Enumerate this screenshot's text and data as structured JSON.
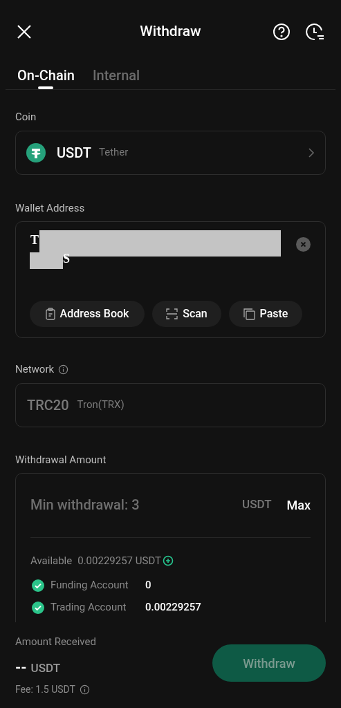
{
  "header": {
    "title": "Withdraw"
  },
  "tabs": [
    {
      "label": "On-Chain",
      "selected": true
    },
    {
      "label": "Internal",
      "selected": false
    }
  ],
  "coin": {
    "label": "Coin",
    "symbol": "USDT",
    "name": "Tether"
  },
  "wallet_address": {
    "label": "Wallet Address",
    "line_1": "T",
    "line_2": "S",
    "buttons": [
      "Address Book",
      "Scan",
      "Paste"
    ]
  },
  "network": {
    "label": "Network",
    "value": "TRC20",
    "name": "Tron(TRX)"
  },
  "withdrawal_amount": {
    "label": "Withdrawal Amount",
    "placeholder": "Min withdrawal: 3",
    "unit": "USDT",
    "max": "Max",
    "available_label": "Available",
    "available_value": "0.00229257 USDT",
    "accounts": [
      {
        "name": "Funding Account",
        "value": "0",
        "checked": true
      },
      {
        "name": "Trading Account",
        "value": "0.00229257",
        "checked": true
      }
    ]
  },
  "footer": {
    "label": "Amount Received",
    "amount": "--",
    "unit": "USDT",
    "fee": "Fee: 1.5 USDT",
    "button": {
      "label": "Withdraw",
      "disabled": true
    }
  }
}
